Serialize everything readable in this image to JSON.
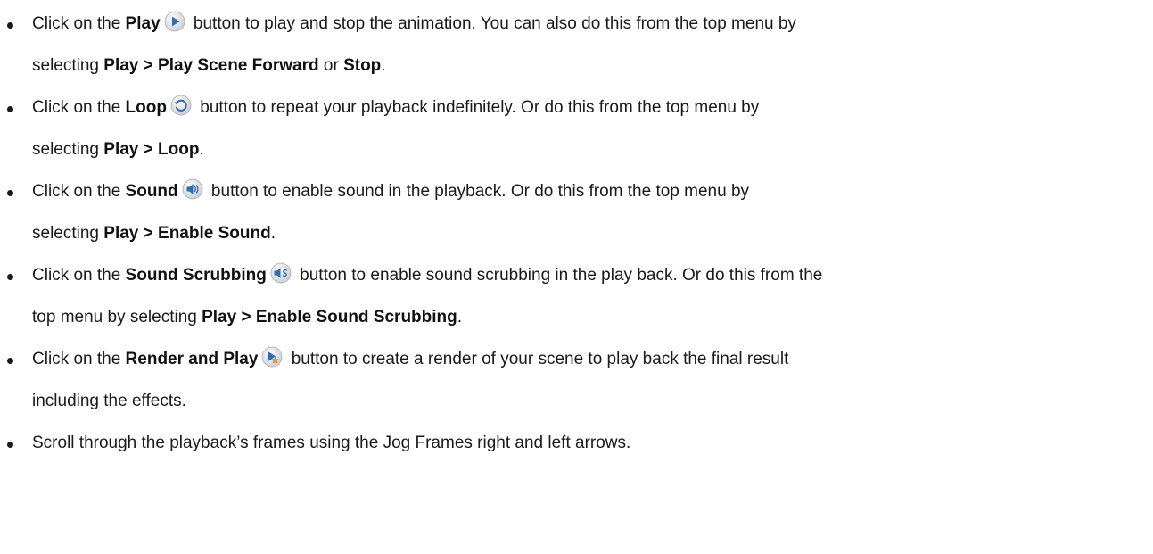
{
  "bullets": [
    {
      "line1": {
        "pre": "Click on the ",
        "bold": "Play",
        "post": " button to play and stop the animation. You can also do this from the top menu by"
      },
      "line2": {
        "pre": "selecting ",
        "bold1": "Play > Play Scene Forward",
        "mid": " or ",
        "bold2": "Stop",
        "post": "."
      }
    },
    {
      "line1": {
        "pre": "Click on the ",
        "bold": "Loop",
        "post": " button to repeat your playback indefinitely. Or do this from the top menu by"
      },
      "line2": {
        "pre": "selecting ",
        "bold1": "Play > Loop",
        "post": "."
      }
    },
    {
      "line1": {
        "pre": "Click on the ",
        "bold": "Sound",
        "post": " button to enable sound in the playback. Or do this from the top menu by"
      },
      "line2": {
        "pre": "selecting ",
        "bold1": "Play > Enable Sound",
        "post": "."
      }
    },
    {
      "line1": {
        "pre": "Click on the ",
        "bold": "Sound Scrubbing",
        "post": " button to enable sound scrubbing in the play back. Or do this from the"
      },
      "line2": {
        "pre": "top menu by selecting ",
        "bold1": "Play > Enable Sound Scrubbing",
        "post": "."
      }
    },
    {
      "line1": {
        "pre": "Click on the ",
        "bold": "Render and Play",
        "post": " button to create a render of your scene to play back the final result"
      },
      "line2": {
        "text": "including the effects."
      }
    },
    {
      "line1": {
        "text": "Scroll through the playback’s frames using the Jog Frames right and left arrows."
      }
    }
  ],
  "icons": [
    "play-icon",
    "loop-icon",
    "sound-icon",
    "sound-scrubbing-icon",
    "render-and-play-icon"
  ],
  "colors": {
    "text": "#1a1a1a",
    "icon_blue": "#2f6db5",
    "icon_bg": "#e4e6ea"
  }
}
